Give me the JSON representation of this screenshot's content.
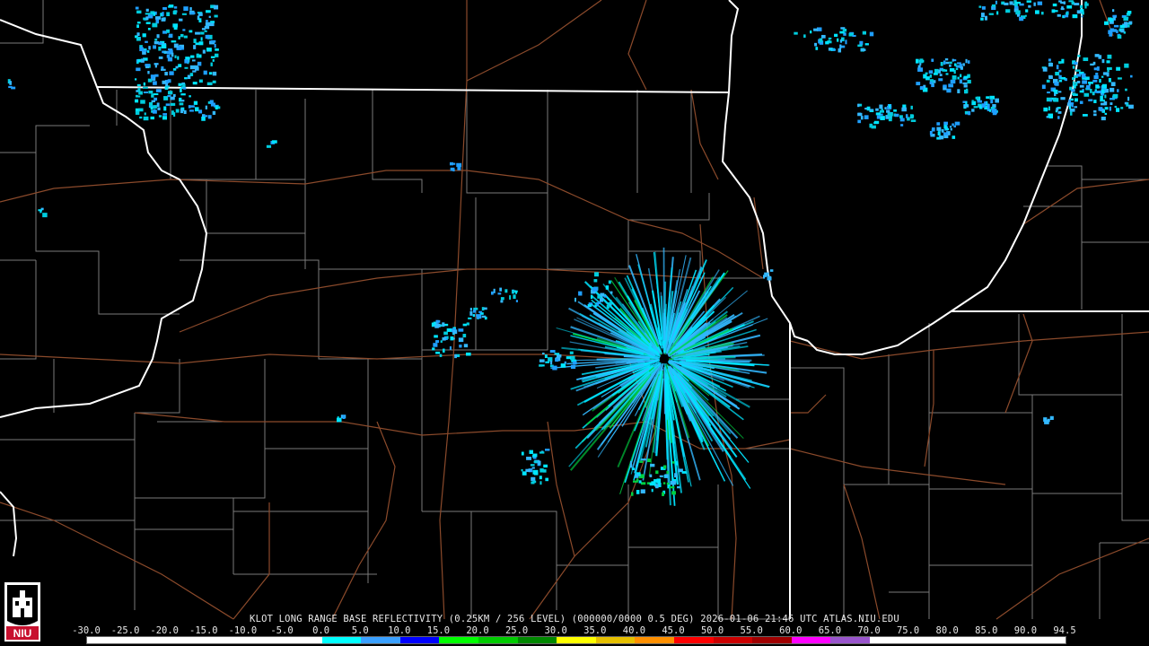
{
  "caption": "KLOT LONG RANGE BASE REFLECTIVITY (0.25KM / 256 LEVEL) (000000/0000 0.5 DEG) 2026-01-06 21:46 UTC  ATLAS.NIU.EDU",
  "logo_text": "NIU",
  "scale": {
    "labels": [
      "-30.0",
      "-25.0",
      "-20.0",
      "-15.0",
      "-10.0",
      "-5.0",
      "0.0",
      "5.0",
      "10.0",
      "15.0",
      "20.0",
      "25.0",
      "30.0",
      "35.0",
      "40.0",
      "45.0",
      "50.0",
      "55.0",
      "60.0",
      "65.0",
      "70.0",
      "75.0",
      "80.0",
      "85.0",
      "90.0",
      "94.5"
    ],
    "colors": [
      "#ffffff",
      "#ffffff",
      "#ffffff",
      "#ffffff",
      "#ffffff",
      "#ffffff",
      "#00ffff",
      "#3aa0ff",
      "#0000ff",
      "#00ff00",
      "#00cc00",
      "#008800",
      "#ffff00",
      "#e6c000",
      "#ff9000",
      "#ff0000",
      "#cc0000",
      "#a00000",
      "#ff00ff",
      "#9955cc",
      "#ffffff",
      "#ffffff",
      "#ffffff",
      "#ffffff",
      "#ffffff"
    ]
  },
  "colors": {
    "state_border": "#ffffff",
    "county_line": "#7a7a7a",
    "highway": "#8b4a2b"
  }
}
